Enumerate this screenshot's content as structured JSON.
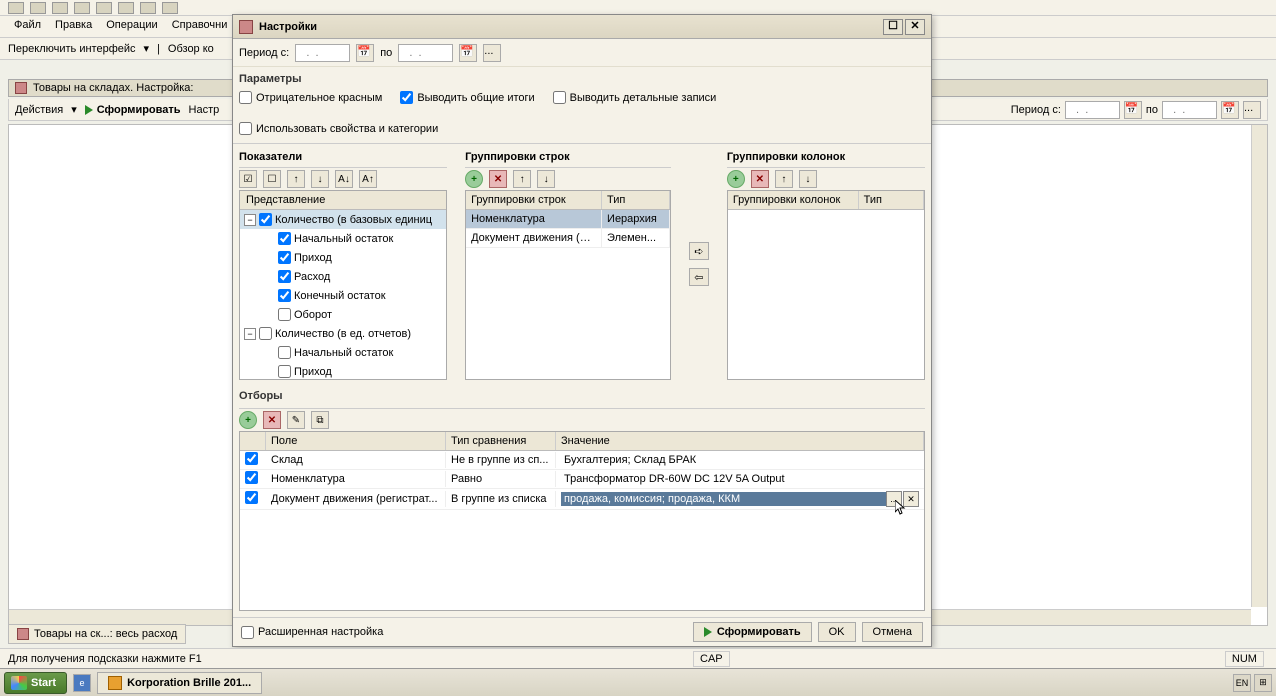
{
  "menubar": {
    "file": "Файл",
    "edit": "Правка",
    "operations": "Операции",
    "reference": "Справочни"
  },
  "subtoolbar": {
    "switch_interface": "Переключить интерфейс",
    "overview": "Обзор ко"
  },
  "report_tab": {
    "title": "Товары на складах. Настройка:"
  },
  "actions_bar": {
    "actions": "Действия",
    "generate": "Сформировать",
    "setup": "Настр"
  },
  "period": {
    "label_from": "Период с:",
    "label_to": "по",
    "placeholder": "  .  .    "
  },
  "dialog": {
    "title": "Настройки",
    "period_row": {
      "label_from": "Период с:",
      "label_to": "по"
    },
    "ellipsis_btn": "...",
    "params": {
      "label": "Параметры",
      "negative_red": "Отрицательное красным",
      "show_totals": "Выводить общие итоги",
      "show_details": "Выводить детальные записи",
      "use_props": "Использовать свойства и категории"
    },
    "indicators": {
      "label": "Показатели",
      "header": "Представление",
      "items": [
        {
          "label": "Количество (в базовых единиц",
          "checked": true,
          "level": 0,
          "expander": "-"
        },
        {
          "label": "Начальный остаток",
          "checked": true,
          "level": 1
        },
        {
          "label": "Приход",
          "checked": true,
          "level": 1
        },
        {
          "label": "Расход",
          "checked": true,
          "level": 1
        },
        {
          "label": "Конечный остаток",
          "checked": true,
          "level": 1
        },
        {
          "label": "Оборот",
          "checked": false,
          "level": 1
        },
        {
          "label": "Количество (в ед. отчетов)",
          "checked": false,
          "level": 0,
          "expander": "-"
        },
        {
          "label": "Начальный остаток",
          "checked": false,
          "level": 1
        },
        {
          "label": "Приход",
          "checked": false,
          "level": 1
        }
      ]
    },
    "group_rows": {
      "label": "Группировки строк",
      "col1": "Группировки строк",
      "col2": "Тип",
      "rows": [
        {
          "name": "Номенклатура",
          "type": "Иерархия",
          "selected": true
        },
        {
          "name": "Документ движения (рег...",
          "type": "Элемен..."
        }
      ]
    },
    "group_cols": {
      "label": "Группировки колонок",
      "col1": "Группировки колонок",
      "col2": "Тип"
    },
    "filters": {
      "label": "Отборы",
      "col_field": "Поле",
      "col_cmp": "Тип сравнения",
      "col_val": "Значение",
      "rows": [
        {
          "field": "Склад",
          "cmp": "Не в группе из сп...",
          "val": "Бухгалтерия; Склад БРАК"
        },
        {
          "field": "Номенклатура",
          "cmp": "Равно",
          "val": "Трансформатор DR-60W DC 12V 5A Output"
        },
        {
          "field": "Документ движения (регистрат...",
          "cmp": "В группе из списка",
          "val": "продажа, комиссия; продажа, ККМ",
          "selected": true
        }
      ]
    },
    "footer": {
      "extended": "Расширенная настройка",
      "generate": "Сформировать",
      "ok": "OK",
      "cancel": "Отмена"
    }
  },
  "doc_tab": "Товары на ск...: весь расход",
  "status_hint": "Для получения подсказки нажмите F1",
  "status_cap": "CAP",
  "status_num": "NUM",
  "taskbar": {
    "start": "Start",
    "app": "Korporation Brille 201...",
    "tray_lang": "EN"
  }
}
